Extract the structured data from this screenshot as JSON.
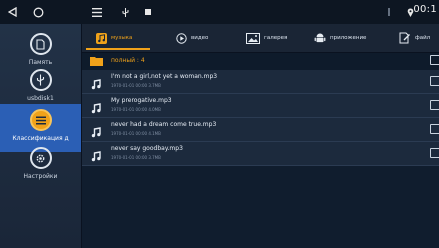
{
  "status_bar": {
    "clock": "00:1",
    "icons": [
      "back-triangle-icon",
      "home-circle-icon",
      "menu-icon",
      "usb-icon",
      "image-icon",
      "notification-icon",
      "location-pin-icon"
    ]
  },
  "sidebar": {
    "items": [
      {
        "label": "Память",
        "icon": "sd-card-icon"
      },
      {
        "label": "usbdisk1",
        "icon": "usb-icon"
      },
      {
        "label": "Классификация д",
        "icon": "list-icon",
        "active": true
      },
      {
        "label": "Настройки",
        "icon": "gear-icon"
      }
    ]
  },
  "tabs": [
    {
      "label": "музыка",
      "icon": "music-note-icon",
      "active": true
    },
    {
      "label": "видео",
      "icon": "play-icon"
    },
    {
      "label": "галерея",
      "icon": "image-icon"
    },
    {
      "label": "приложение",
      "icon": "android-icon"
    },
    {
      "label": "файл",
      "icon": "file-edit-icon"
    }
  ],
  "folder": {
    "label": "полный : 4"
  },
  "files": [
    {
      "name": "I'm not a girl,not yet a woman.mp3",
      "meta": "1970-01-01 00:00  3.7MB"
    },
    {
      "name": "My prerogative.mp3",
      "meta": "1970-01-01 00:00  4.0MB"
    },
    {
      "name": "never had a dream come true.mp3",
      "meta": "1970-01-01 00:00  4.1MB"
    },
    {
      "name": "never say goodbay.mp3",
      "meta": "1970-01-01 00:00  3.7MB"
    }
  ],
  "colors": {
    "accent": "#f0a21a",
    "active_side": "#2b5fb5",
    "background": "#0e1b2b"
  }
}
